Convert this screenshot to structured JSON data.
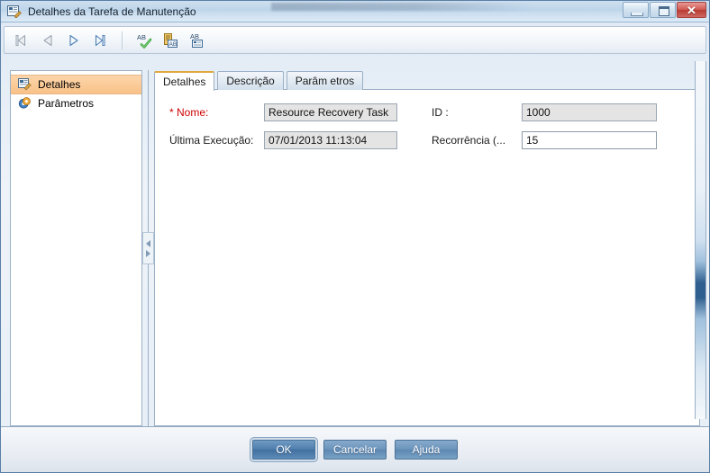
{
  "window": {
    "title": "Detalhes da Tarefa de Manutenção",
    "icon": "document-edit-icon",
    "controls": {
      "minimize": "minimize-button",
      "maximize": "maximize-button",
      "close_glyph": "✕"
    }
  },
  "toolbar": {
    "buttons": [
      {
        "name": "first-record-button",
        "icon": "first-record-icon",
        "enabled": false
      },
      {
        "name": "previous-record-button",
        "icon": "previous-record-icon",
        "enabled": false
      },
      {
        "name": "next-record-button",
        "icon": "next-record-icon",
        "enabled": true
      },
      {
        "name": "last-record-button",
        "icon": "last-record-icon",
        "enabled": true
      },
      {
        "name": "spellcheck-button",
        "icon": "spellcheck-icon",
        "enabled": true
      },
      {
        "name": "translate-button",
        "icon": "translate-document-icon",
        "enabled": true
      },
      {
        "name": "properties-button",
        "icon": "text-properties-icon",
        "enabled": true
      }
    ]
  },
  "sidebar": {
    "items": [
      {
        "label": "Detalhes",
        "icon": "document-edit-icon",
        "selected": true
      },
      {
        "label": "Parâmetros",
        "icon": "gear-icon",
        "selected": false
      }
    ]
  },
  "splitter": {
    "collapse_icon": "chevron-left-icon",
    "expand_icon": "chevron-right-icon"
  },
  "tabs": [
    {
      "label": "Detalhes",
      "active": true
    },
    {
      "label": "Descrição",
      "active": false
    },
    {
      "label": "Parâm etros",
      "active": false
    }
  ],
  "form": {
    "fields": [
      {
        "label": "* Nome:",
        "required": true,
        "value": "Resource Recovery Task",
        "readonly": true,
        "name": "nome"
      },
      {
        "label": "ID :",
        "required": false,
        "value": "1000",
        "readonly": true,
        "name": "id"
      },
      {
        "label": "Última Execução:",
        "required": false,
        "value": "07/01/2013 11:13:04",
        "readonly": true,
        "name": "ultima-execucao"
      },
      {
        "label": "Recorrência (...",
        "required": false,
        "value": "15",
        "readonly": false,
        "name": "recorrencia"
      }
    ]
  },
  "footer": {
    "buttons": [
      {
        "label": "OK",
        "default": true,
        "name": "ok-button"
      },
      {
        "label": "Cancelar",
        "default": false,
        "name": "cancel-button"
      },
      {
        "label": "Ajuda",
        "default": false,
        "name": "help-button"
      }
    ]
  },
  "colors": {
    "accent_orange": "#f8c188",
    "required_red": "#cc0000",
    "tab_active_top": "#e0a93f",
    "close_red": "#b83b33",
    "border_blue": "#9bb0c6"
  }
}
